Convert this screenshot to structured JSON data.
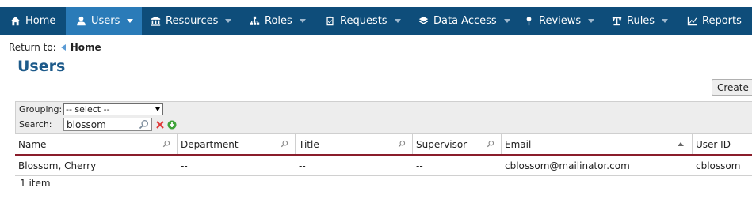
{
  "nav": {
    "items": [
      {
        "label": "Home",
        "icon": "home-icon",
        "active": false,
        "caret": false
      },
      {
        "label": "Users",
        "icon": "user-icon",
        "active": true,
        "caret": true
      },
      {
        "label": "Resources",
        "icon": "bank-icon",
        "active": false,
        "caret": true
      },
      {
        "label": "Roles",
        "icon": "org-chart-icon",
        "active": false,
        "caret": true
      },
      {
        "label": "Requests",
        "icon": "clipboard-check-icon",
        "active": false,
        "caret": true
      },
      {
        "label": "Data Access",
        "icon": "layers-icon",
        "active": false,
        "caret": true
      },
      {
        "label": "Reviews",
        "icon": "pin-icon",
        "active": false,
        "caret": true
      },
      {
        "label": "Rules",
        "icon": "gavel-icon",
        "active": false,
        "caret": true
      },
      {
        "label": "Reports",
        "icon": "chart-icon",
        "active": false,
        "caret": false
      }
    ]
  },
  "breadcrumb": {
    "prefix": "Return to:",
    "home": "Home"
  },
  "page": {
    "title": "Users",
    "create_label": "Create F"
  },
  "filters": {
    "grouping_label": "Grouping:",
    "grouping_value": "-- select --",
    "search_label": "Search:",
    "search_value": "blossom"
  },
  "table": {
    "columns": [
      "Name",
      "Department",
      "Title",
      "Supervisor",
      "Email",
      "User ID"
    ],
    "rows": [
      [
        "Blossom, Cherry",
        "--",
        "--",
        "--",
        "cblossom@mailinator.com",
        "cblossom"
      ]
    ],
    "count_label": "1 item"
  },
  "colors": {
    "nav_bg": "#0e4d7a",
    "nav_active": "#2a7bb8",
    "title": "#1d5a8a",
    "header_rule": "#8a1d2b"
  }
}
